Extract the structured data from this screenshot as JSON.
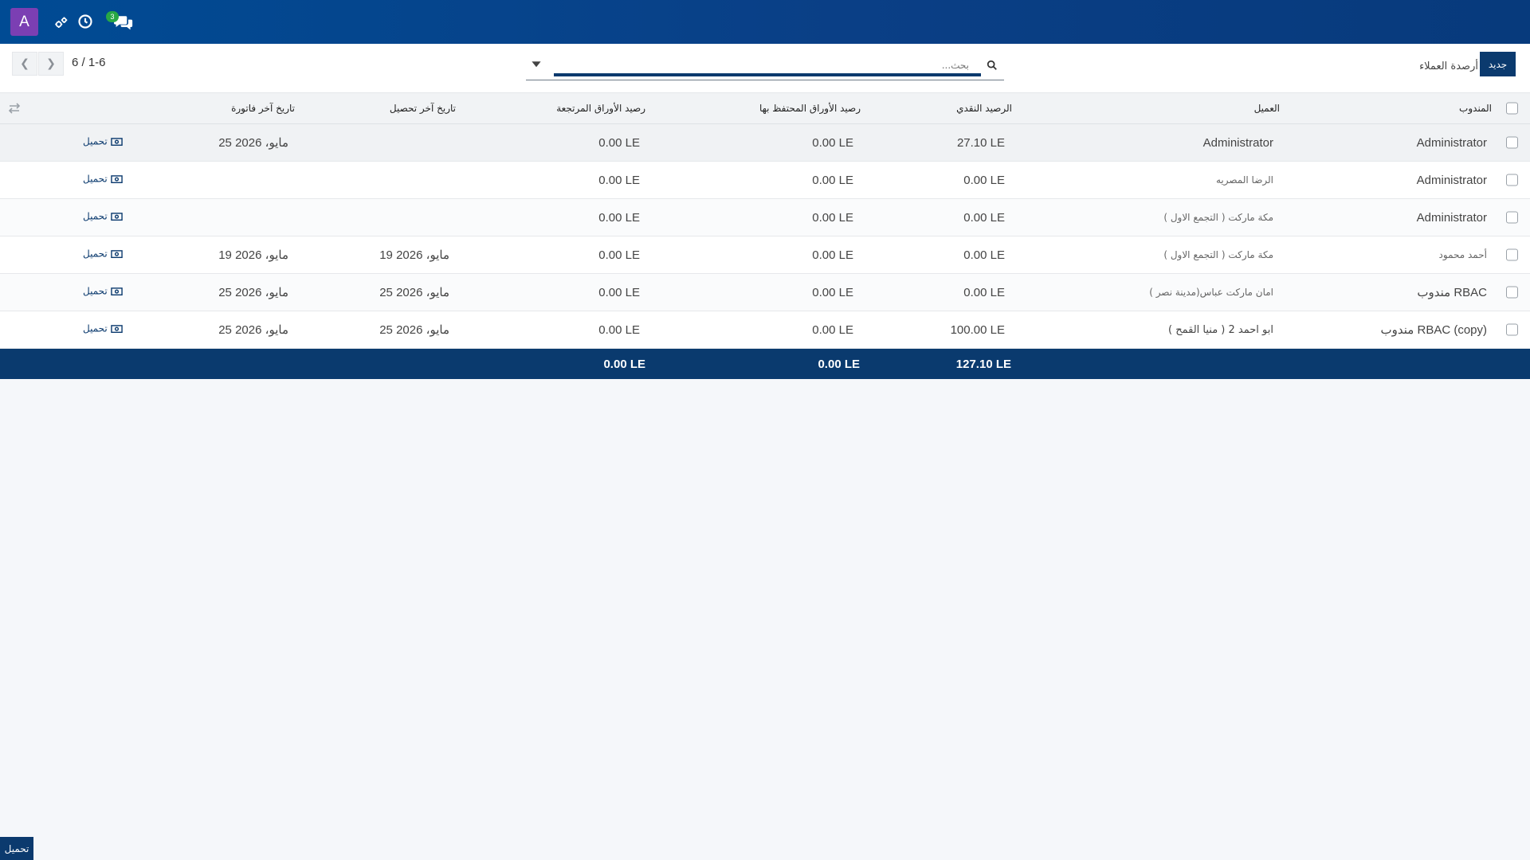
{
  "navbar": {
    "avatar_letter": "A",
    "icons": [
      "settings-icon",
      "clock-icon",
      "chat-icon"
    ],
    "chat_badge": "3"
  },
  "control": {
    "new_button": "جديد",
    "title": "أرصدة العملاء",
    "search_placeholder": "بحث...",
    "pager_value": "6 / 1-6"
  },
  "table": {
    "columns": [
      "المندوب",
      "العميل",
      "الرصيد النقدي",
      "رصيد الأوراق المحتفظ بها",
      "رصيد الأوراق المرتجعة",
      "تاريخ آخر تحصيل",
      "تاريخ آخر فاتورة"
    ],
    "rows": [
      {
        "rep": "Administrator",
        "customer": "Administrator",
        "cash": "27.10 LE",
        "held": "0.00 LE",
        "returned": "0.00 LE",
        "last_collection": "",
        "last_invoice": "25 مايو، 2026",
        "action": "تحميل"
      },
      {
        "rep": "Administrator",
        "customer": "الرضا المصريه",
        "cash": "0.00 LE",
        "held": "0.00 LE",
        "returned": "0.00 LE",
        "last_collection": "",
        "last_invoice": "",
        "action": "تحميل"
      },
      {
        "rep": "Administrator",
        "customer": "مكة ماركت ( التجمع الاول )",
        "cash": "0.00 LE",
        "held": "0.00 LE",
        "returned": "0.00 LE",
        "last_collection": "",
        "last_invoice": "",
        "action": "تحميل"
      },
      {
        "rep": "أحمد محمود",
        "customer": "مكة ماركت ( التجمع الاول )",
        "cash": "0.00 LE",
        "held": "0.00 LE",
        "returned": "0.00 LE",
        "last_collection": "19 مايو، 2026",
        "last_invoice": "19 مايو، 2026",
        "action": "تحميل"
      },
      {
        "rep": "مندوب RBAC",
        "customer": "( امان ماركت عباس(مدينة نصر",
        "cash": "0.00 LE",
        "held": "0.00 LE",
        "returned": "0.00 LE",
        "last_collection": "25 مايو، 2026",
        "last_invoice": "25 مايو، 2026",
        "action": "تحميل"
      },
      {
        "rep": "مندوب RBAC (copy)",
        "customer": "ابو احمد 2 ( منيا القمح )",
        "cash": "100.00 LE",
        "held": "0.00 LE",
        "returned": "0.00 LE",
        "last_collection": "25 مايو، 2026",
        "last_invoice": "25 مايو، 2026",
        "action": "تحميل"
      }
    ],
    "totals": {
      "cash": "127.10 LE",
      "held": "0.00 LE",
      "returned": "0.00 LE"
    }
  },
  "footer": {
    "button": "تحميل"
  }
}
